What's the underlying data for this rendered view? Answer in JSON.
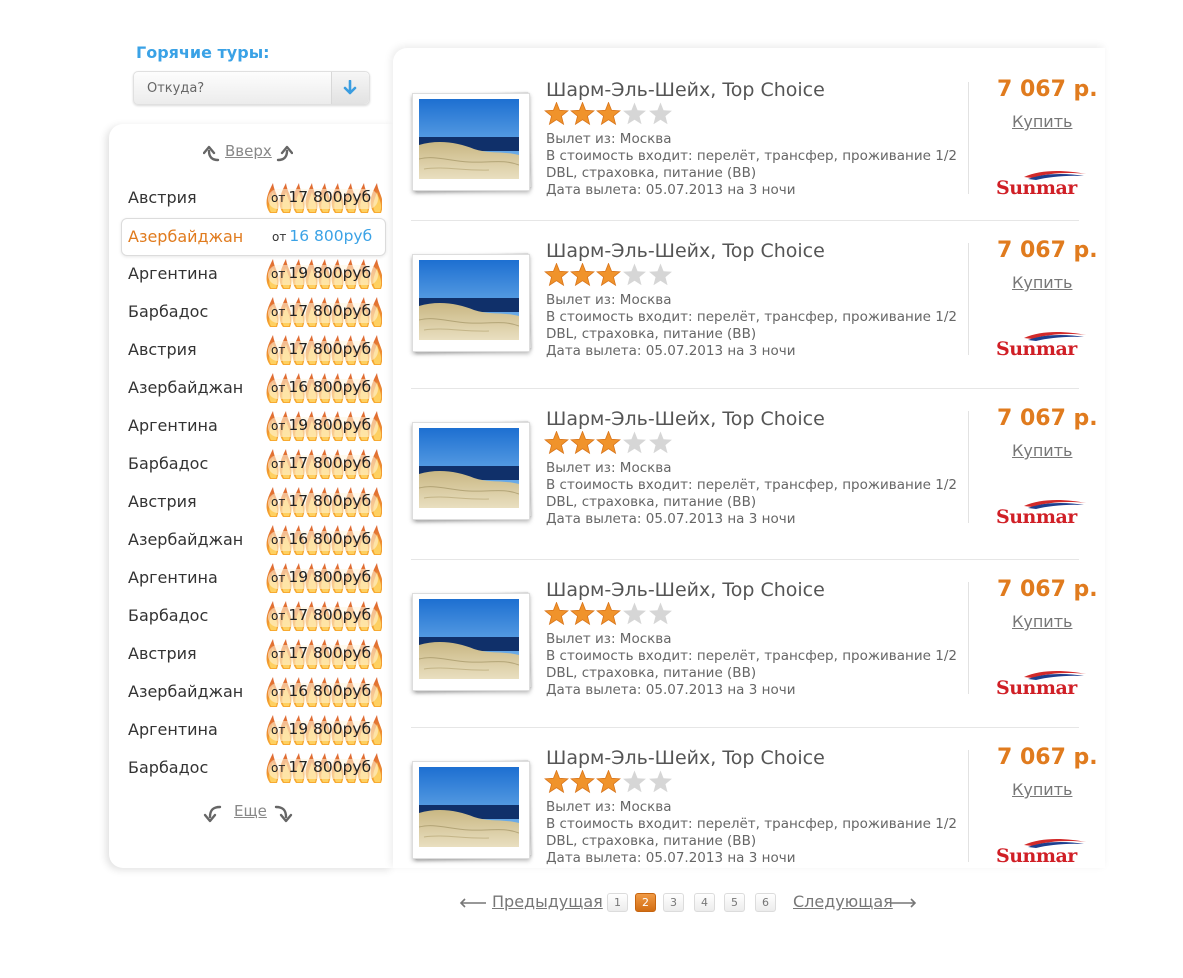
{
  "hot_tours": {
    "title": "Горячие туры:",
    "from_select": {
      "value": "Откуда?",
      "icon": "arrow-down-icon"
    }
  },
  "countries": {
    "up_label": "Вверх",
    "more_label": "Еще",
    "items": [
      {
        "name": "Австрия",
        "prefix": "от",
        "price": "17 800руб",
        "active": false
      },
      {
        "name": "Азербайджан",
        "prefix": "от",
        "price": "16 800руб",
        "active": true
      },
      {
        "name": "Аргентина",
        "prefix": "от",
        "price": "19 800руб",
        "active": false
      },
      {
        "name": "Барбадос",
        "prefix": "от",
        "price": "17 800руб",
        "active": false
      },
      {
        "name": "Австрия",
        "prefix": "от",
        "price": "17 800руб",
        "active": false
      },
      {
        "name": "Азербайджан",
        "prefix": "от",
        "price": "16 800руб",
        "active": false
      },
      {
        "name": "Аргентина",
        "prefix": "от",
        "price": "19 800руб",
        "active": false
      },
      {
        "name": "Барбадос",
        "prefix": "от",
        "price": "17 800руб",
        "active": false
      },
      {
        "name": "Австрия",
        "prefix": "от",
        "price": "17 800руб",
        "active": false
      },
      {
        "name": "Азербайджан",
        "prefix": "от",
        "price": "16 800руб",
        "active": false
      },
      {
        "name": "Аргентина",
        "prefix": "от",
        "price": "19 800руб",
        "active": false
      },
      {
        "name": "Барбадос",
        "prefix": "от",
        "price": "17 800руб",
        "active": false
      },
      {
        "name": "Австрия",
        "prefix": "от",
        "price": "17 800руб",
        "active": false
      },
      {
        "name": "Азербайджан",
        "prefix": "от",
        "price": "16 800руб",
        "active": false
      },
      {
        "name": "Аргентина",
        "prefix": "от",
        "price": "19 800руб",
        "active": false
      },
      {
        "name": "Барбадос",
        "prefix": "от",
        "price": "17 800руб",
        "active": false
      }
    ]
  },
  "tours": [
    {
      "title": "Шарм-Эль-Шейх, Top Choice",
      "rating": 3,
      "max_rating": 5,
      "departure": "Вылет из: Москва",
      "includes_1": "В стоимость входит: перелёт, трансфер, проживание  1/2",
      "includes_2": "DBL, страховка, питание (BB)",
      "date": "Дата вылета: 05.07.2013 на 3 ночи",
      "price": "7 067 р.",
      "buy_label": "Купить",
      "operator_logo": "Sunmar"
    },
    {
      "title": "Шарм-Эль-Шейх, Top Choice",
      "rating": 3,
      "max_rating": 5,
      "departure": "Вылет из: Москва",
      "includes_1": "В стоимость входит: перелёт, трансфер, проживание  1/2",
      "includes_2": "DBL, страховка, питание (BB)",
      "date": "Дата вылета: 05.07.2013 на 3 ночи",
      "price": "7 067 р.",
      "buy_label": "Купить",
      "operator_logo": "Sunmar"
    },
    {
      "title": "Шарм-Эль-Шейх, Top Choice",
      "rating": 3,
      "max_rating": 5,
      "departure": "Вылет из: Москва",
      "includes_1": "В стоимость входит: перелёт, трансфер, проживание  1/2",
      "includes_2": "DBL, страховка, питание (BB)",
      "date": "Дата вылета: 05.07.2013 на 3 ночи",
      "price": "7 067 р.",
      "buy_label": "Купить",
      "operator_logo": "Sunmar"
    },
    {
      "title": "Шарм-Эль-Шейх, Top Choice",
      "rating": 3,
      "max_rating": 5,
      "departure": "Вылет из: Москва",
      "includes_1": "В стоимость входит: перелёт, трансфер, проживание  1/2",
      "includes_2": "DBL, страховка, питание (BB)",
      "date": "Дата вылета: 05.07.2013 на 3 ночи",
      "price": "7 067 р.",
      "buy_label": "Купить",
      "operator_logo": "Sunmar"
    },
    {
      "title": "Шарм-Эль-Шейх, Top Choice",
      "rating": 3,
      "max_rating": 5,
      "departure": "Вылет из: Москва",
      "includes_1": "В стоимость входит: перелёт, трансфер, проживание  1/2",
      "includes_2": "DBL, страховка, питание (BB)",
      "date": "Дата вылета: 05.07.2013 на 3 ночи",
      "price": "7 067 р.",
      "buy_label": "Купить",
      "operator_logo": "Sunmar"
    }
  ],
  "pagination": {
    "prev_label": "Предыдущая",
    "next_label": "Следующая",
    "pages": [
      "1",
      "2",
      "3",
      "4",
      "5",
      "6"
    ],
    "current": "2"
  },
  "colors": {
    "accent_orange": "#e07b1e",
    "accent_blue": "#3aa2e6",
    "star_filled": "#f0932b",
    "star_empty": "#d6d6d6"
  }
}
